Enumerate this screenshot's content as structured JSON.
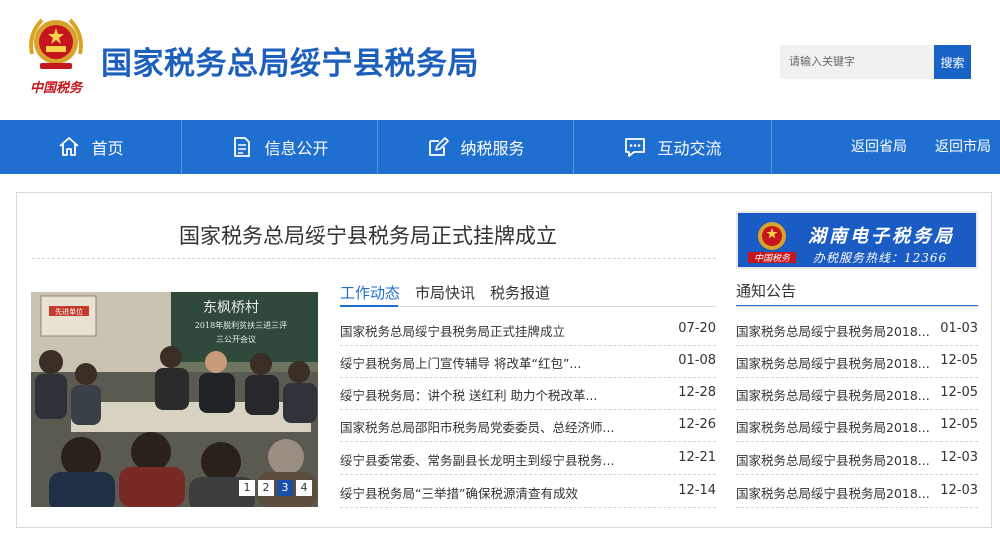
{
  "header": {
    "logo_caption": "中国税务",
    "site_title": "国家税务总局绥宁县税务局",
    "search_placeholder": "请输入关键字",
    "search_button": "搜索"
  },
  "nav": {
    "items": [
      {
        "label": "首页",
        "icon": "home-icon"
      },
      {
        "label": "信息公开",
        "icon": "document-icon"
      },
      {
        "label": "纳税服务",
        "icon": "edit-icon"
      },
      {
        "label": "互动交流",
        "icon": "chat-icon"
      }
    ],
    "links": [
      "返回省局",
      "返回市局"
    ]
  },
  "headline": "国家税务总局绥宁县税务局正式挂牌成立",
  "slideshow": {
    "board_text_1": "东枫桥村",
    "board_text_2": "2018年脱利贫扶三进三评",
    "board_text_3": "三公开会议",
    "sign_text": "先进单位",
    "dots": [
      "1",
      "2",
      "3",
      "4"
    ],
    "active_dot": 3
  },
  "tabs": [
    "工作动态",
    "市局快讯",
    "税务报道"
  ],
  "news": [
    {
      "title": "国家税务总局绥宁县税务局正式挂牌成立",
      "date": "07-20"
    },
    {
      "title": "绥宁县税务局上门宣传辅导 将改革“红包”...",
      "date": "01-08"
    },
    {
      "title": "绥宁县税务局：讲个税 送红利 助力个税改革...",
      "date": "12-28"
    },
    {
      "title": "国家税务总局邵阳市税务局党委委员、总经济师...",
      "date": "12-26"
    },
    {
      "title": "绥宁县委常委、常务副县长龙明主到绥宁县税务...",
      "date": "12-21"
    },
    {
      "title": "绥宁县税务局“三举措”确保税源清查有成效",
      "date": "12-14"
    }
  ],
  "banner": {
    "title": "湖南电子税务局",
    "subtitle": "办税服务热线：12366",
    "logo_caption": "中国税务"
  },
  "notices": {
    "title": "通知公告",
    "items": [
      {
        "title": "国家税务总局绥宁县税务局2018...",
        "date": "01-03"
      },
      {
        "title": "国家税务总局绥宁县税务局2018...",
        "date": "12-05"
      },
      {
        "title": "国家税务总局绥宁县税务局2018...",
        "date": "12-05"
      },
      {
        "title": "国家税务总局绥宁县税务局2018...",
        "date": "12-05"
      },
      {
        "title": "国家税务总局绥宁县税务局2018...",
        "date": "12-03"
      },
      {
        "title": "国家税务总局绥宁县税务局2018...",
        "date": "12-03"
      }
    ]
  },
  "colors": {
    "brand_blue": "#1f6fd1",
    "title_blue": "#1c5fbd",
    "logo_red": "#c4161c"
  }
}
